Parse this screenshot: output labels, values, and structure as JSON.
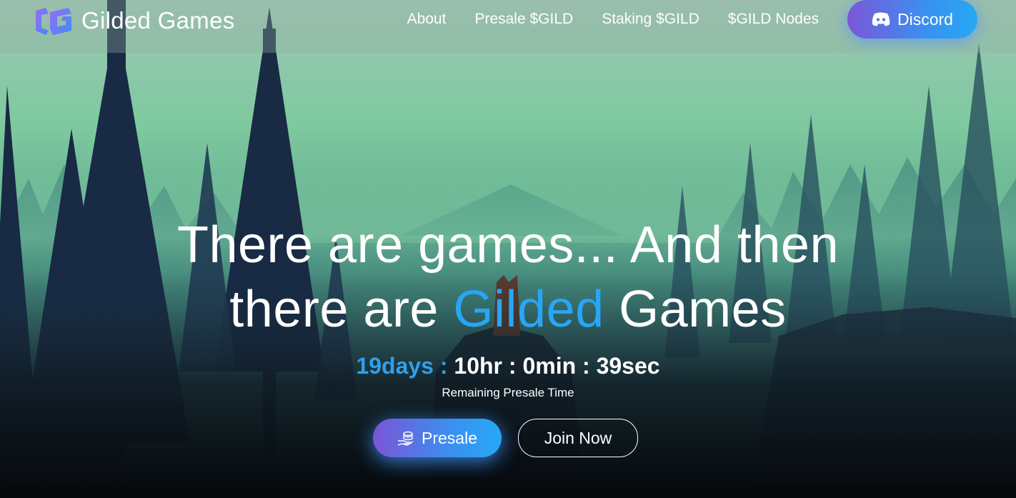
{
  "brand": {
    "name": "Gilded Games",
    "logo_icon": "gilded-games-logo-icon"
  },
  "nav": {
    "links": [
      {
        "label": "About"
      },
      {
        "label": "Presale $GILD"
      },
      {
        "label": "Staking $GILD"
      },
      {
        "label": "$GILD Nodes"
      }
    ],
    "discord_label": "Discord",
    "discord_icon": "discord-icon"
  },
  "hero": {
    "line1": "There are games... And then",
    "line2_prefix": "there are ",
    "line2_accent": "Gilded",
    "line2_suffix": " Games"
  },
  "countdown": {
    "days": "19days : ",
    "hours": "10hr",
    "sep1": " : ",
    "minutes": "0min",
    "sep2": " : ",
    "seconds": "39sec",
    "caption": "Remaining Presale Time"
  },
  "actions": {
    "presale_label": "Presale",
    "presale_icon": "coins-in-hand-icon",
    "join_label": "Join Now"
  },
  "colors": {
    "accent_blue": "#28a6f5",
    "gradient_purple": "#7a55d6",
    "text": "#ffffff"
  }
}
